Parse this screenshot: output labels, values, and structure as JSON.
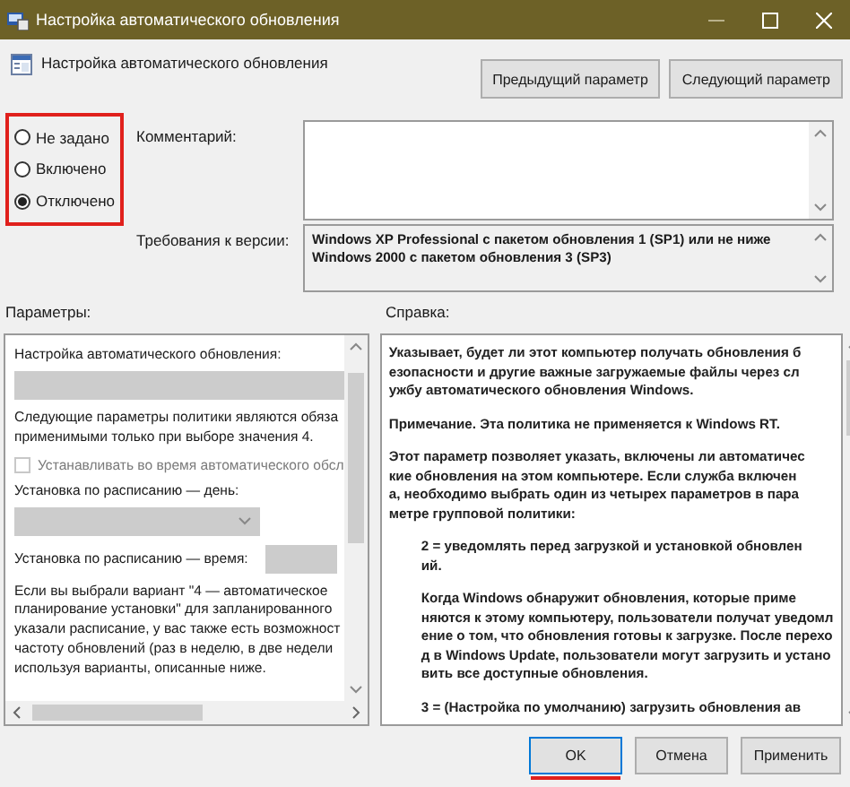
{
  "window": {
    "title": "Настройка автоматического обновления"
  },
  "header": {
    "title": "Настройка автоматического обновления"
  },
  "nav_buttons": [
    "Предыдущий параметр",
    "Следующий параметр"
  ],
  "state_options": {
    "highlighted": true,
    "items": [
      {
        "label": "Не задано",
        "selected": false
      },
      {
        "label": "Включено",
        "selected": false
      },
      {
        "label": "Отключено",
        "selected": true
      }
    ]
  },
  "comment": {
    "label": "Комментарий:"
  },
  "requirements": {
    "label": "Требования к версии:",
    "lines": [
      "Windows XP Professional с пакетом обновления 1 (SP1) или не ниже",
      "Windows 2000 с пакетом обновления 3 (SP3)"
    ]
  },
  "options": {
    "label": "Параметры:",
    "items": [
      {
        "kind": "label",
        "text": "Настройка автоматического обновления:"
      },
      {
        "kind": "field",
        "disabled": true
      },
      {
        "kind": "paragraph",
        "lines": [
          "Следующие параметры политики являются обяза",
          "применимыми только при выборе значения 4."
        ]
      },
      {
        "kind": "checkbox",
        "text": "Устанавливать во время автоматического обсл",
        "checked": false,
        "disabled": true
      },
      {
        "kind": "label",
        "text": "Установка по расписанию — день:"
      },
      {
        "kind": "dropdown",
        "disabled": true
      },
      {
        "kind": "time",
        "text": "Установка по расписанию — время:",
        "disabled": true
      },
      {
        "kind": "paragraph",
        "lines": [
          "Если вы выбрали вариант \"4 — автоматическое",
          "планирование установки\" для запланированного",
          "указали расписание, у вас также есть возможност",
          "частоту обновлений (раз в неделю, в две недели",
          "используя варианты, описанные ниже."
        ]
      }
    ]
  },
  "help": {
    "label": "Справка:",
    "paragraphs": [
      {
        "indented": false,
        "lines": [
          "Указывает, будет ли этот компьютер получать обновления б",
          "езопасности и другие важные загружаемые файлы через сл",
          "ужбу автоматического обновления Windows."
        ]
      },
      {
        "indented": false,
        "lines": [
          "Примечание. Эта политика не применяется к Windows RT."
        ]
      },
      {
        "indented": false,
        "lines": [
          "Этот параметр позволяет указать, включены ли автоматичес",
          "кие обновления на этом компьютере. Если служба включен",
          "а, необходимо выбрать один из четырех параметров в пара",
          "метре групповой политики:"
        ]
      },
      {
        "indented": true,
        "lines": [
          "2 = уведомлять перед загрузкой и установкой обновлен",
          "ий."
        ]
      },
      {
        "indented": true,
        "lines": [
          "Когда Windows обнаружит обновления, которые приме",
          "няются к этому компьютеру, пользователи получат уведомл",
          "ение о том, что обновления готовы к загрузке. После перехо",
          "д в Windows Update, пользователи могут загрузить и устано",
          "вить все доступные обновления."
        ]
      },
      {
        "indented": true,
        "lines": [
          "3 = (Настройка по умолчанию) загрузить обновления ав"
        ]
      }
    ]
  },
  "buttons": [
    {
      "label": "OK",
      "default": true,
      "underlined": true
    },
    {
      "label": "Отмена",
      "default": false,
      "underlined": false
    },
    {
      "label": "Применить",
      "default": false,
      "underlined": false
    }
  ]
}
